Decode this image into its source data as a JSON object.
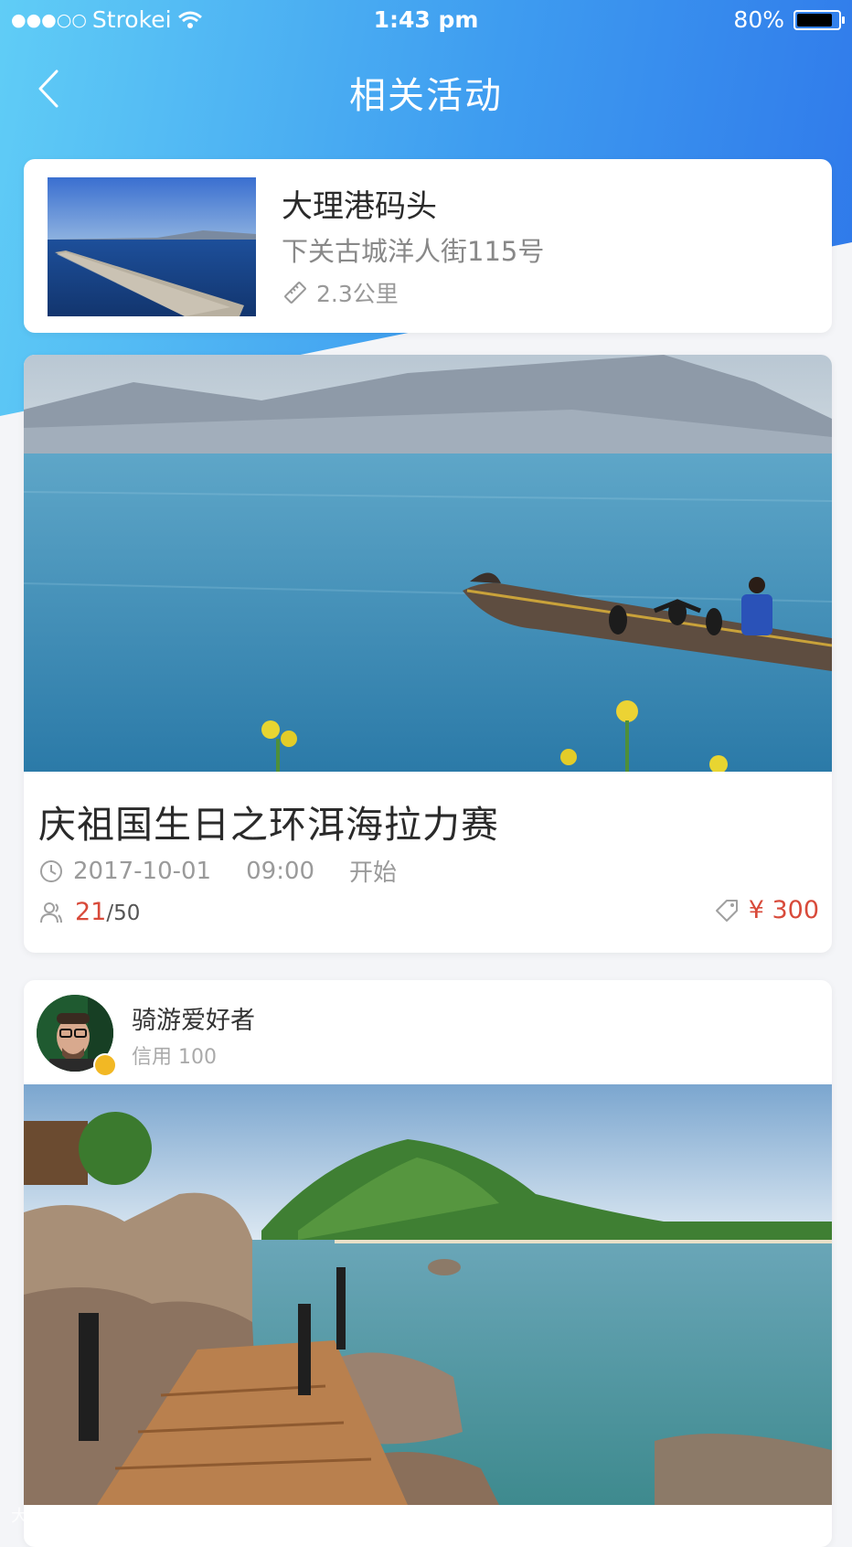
{
  "status_bar": {
    "signal": "●●●○○",
    "carrier": "Strokei",
    "time": "1:43 pm",
    "battery": "80%"
  },
  "nav": {
    "title": "相关活动"
  },
  "location": {
    "name": "大理港码头",
    "address": "下关古城洋人街115号",
    "distance": "2.3公里"
  },
  "activity": {
    "title": "庆祖国生日之环洱海拉力赛",
    "date": "2017-10-01",
    "time": "09:00",
    "start_label": "开始",
    "joined": "21",
    "capacity": "/50",
    "price": "¥ 300"
  },
  "post": {
    "user_name": "骑游爱好者",
    "credit": "信用 100"
  },
  "watermark": "大数跨境",
  "colors": {
    "accent": "#3e9cf0",
    "price": "#d84a3a"
  }
}
